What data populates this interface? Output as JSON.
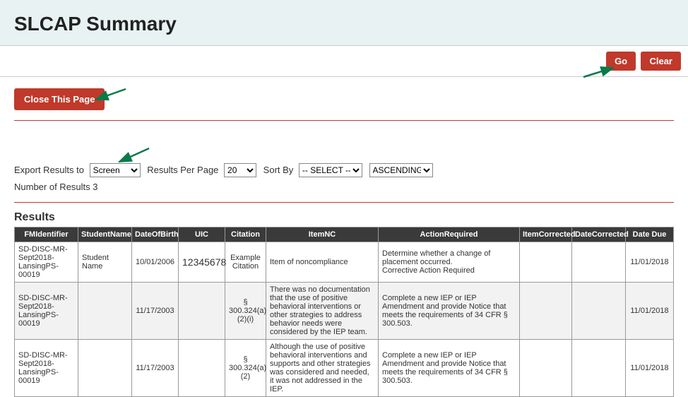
{
  "header": {
    "title": "SLCAP Summary"
  },
  "topButtons": {
    "go": "Go",
    "clear": "Clear"
  },
  "closeButton": {
    "label": "Close This Page"
  },
  "controls": {
    "exportLabel": "Export Results to",
    "exportSelected": "Screen",
    "rppLabel": "Results Per Page",
    "rppSelected": "20",
    "sortByLabel": "Sort By",
    "sortBySelected": "-- SELECT --",
    "sortDirSelected": "ASCENDING"
  },
  "numResults": {
    "label": "Number of Results ",
    "value": "3"
  },
  "resultsHeading": "Results",
  "columns": {
    "c0": "FMIdentifier",
    "c1": "StudentName",
    "c2": "DateOfBirth",
    "c3": "UIC",
    "c4": "Citation",
    "c5": "ItemNC",
    "c6": "ActionRequired",
    "c7": "ItemCorrected",
    "c8": "DateCorrected",
    "c9": "Date Due"
  },
  "rows": [
    {
      "fmid": "SD-DISC-MR-Sept2018-LansingPS-00019",
      "student": "Student Name",
      "dob": "10/01/2006",
      "uic": "12345678",
      "citation": "Example Citation",
      "itemnc": "Item of noncompliance",
      "action": "Determine whether a change of placement occurred.\nCorrective Action Required",
      "corrected": "",
      "datecorr": "",
      "due": "11/01/2018"
    },
    {
      "fmid": "SD-DISC-MR-Sept2018-LansingPS-00019",
      "student": "",
      "dob": "11/17/2003",
      "uic": "",
      "citation": "§ 300.324(a)(2)(i)",
      "itemnc": "There was no documentation that the use of positive behavioral interventions or other strategies to address behavior needs were considered by the IEP team.",
      "action": "Complete a new IEP or IEP Amendment and provide Notice that meets the requirements of 34 CFR § 300.503.",
      "corrected": "",
      "datecorr": "",
      "due": "11/01/2018"
    },
    {
      "fmid": "SD-DISC-MR-Sept2018-LansingPS-00019",
      "student": "",
      "dob": "11/17/2003",
      "uic": "",
      "citation": "§ 300.324(a)(2)",
      "itemnc": "Although the use of positive behavioral interventions and supports and other strategies was considered and needed, it was not addressed in the IEP.",
      "action": "Complete a new IEP or IEP Amendment and provide Notice that meets the requirements of 34 CFR § 300.503.",
      "corrected": "",
      "datecorr": "",
      "due": "11/01/2018"
    }
  ]
}
